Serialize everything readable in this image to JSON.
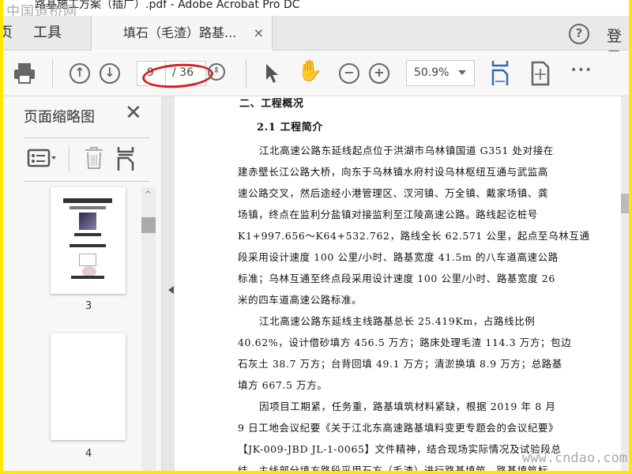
{
  "window": {
    "title": "路基施工方案（插广）.pdf - Adobe Acrobat Pro DC",
    "watermark_top": "中国道桥网",
    "watermark_bottom": "www.cndao.com"
  },
  "tabs": {
    "home_partial": "页",
    "tools": "工具",
    "document": "填石（毛渣）路基...",
    "close": "×",
    "help": "?",
    "login_partial": "登录"
  },
  "toolbar": {
    "current_page": "9",
    "total_pages": "/ 36",
    "zoom": "50.9%",
    "more": "•••"
  },
  "sidebar": {
    "title": "页面缩略图",
    "close": "✕",
    "thumbnails": [
      {
        "label": "3"
      },
      {
        "label": "4"
      }
    ]
  },
  "document": {
    "lines": [
      "二、工程概况",
      "2.1 工程简介",
      "江北高速公路东延线起点位于洪湖市乌林镇国道 G351 处对接在",
      "建赤壁长江公路大桥，向东于乌林镇水府村设乌林枢纽互通与武监高",
      "速公路交叉，然后途经小港管理区、汊河镇、万全镇、戴家场镇、龚",
      "场镇，终点在监利分盐镇对接监利至江陵高速公路。路线起讫桩号",
      "K1+997.656～K64+532.762，路线全长 62.571 公里，起点至乌林互通",
      "段采用设计速度 100 公里/小时、路基宽度 41.5m 的八车道高速公路",
      "标准；乌林互通至终点段采用设计速度 100 公里/小时、路基宽度 26",
      "米的四车道高速公路标准。",
      "江北高速公路东延线主线路基总长 25.419Km，占路线比例",
      "40.62%，设计借砂填方 456.5 万方；路床处理毛渣 114.3 万方；包边",
      "石灰土 38.7 万方；台背回填 49.1 万方；清淤换填 8.9 万方；总路基",
      "填方 667.5 万方。",
      "因项目工期紧，任务重，路基填筑材料紧缺，根据 2019 年 8 月",
      "9 日工地会议纪要《关于江北东高速路基填料变更专题会的会议纪要》",
      "【JK-009-JBD JL-1-0065】文件精神，结合现场实际情况及试验段总",
      "结，主线部分填方路段采用石方（毛渣）进行路基填筑。路基填筑标"
    ]
  },
  "colors": {
    "accent": "#2f6db5",
    "annotation": "#d42020",
    "border": "#ffe800"
  }
}
